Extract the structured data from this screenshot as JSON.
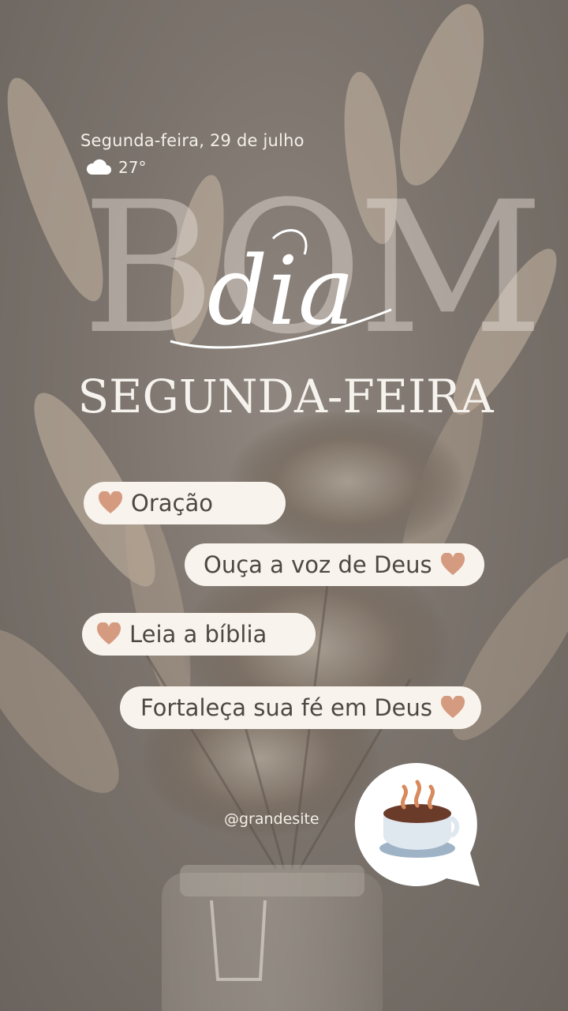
{
  "header": {
    "date": "Segunda-feira, 29 de julho",
    "temperature": "27°"
  },
  "title": {
    "big_word": "BOM",
    "script_word": "dia",
    "weekday": "SEGUNDA-FEIRA"
  },
  "checklist": [
    {
      "label": "Oração"
    },
    {
      "label": "Ouça a voz de Deus"
    },
    {
      "label": "Leia a bíblia"
    },
    {
      "label": "Fortaleça sua fé em Deus"
    }
  ],
  "footer": {
    "handle": "@grandesite"
  },
  "icons": {
    "weather": "cloud-icon",
    "list": "heart-icon",
    "sticker": "hot-coffee-icon"
  },
  "colors": {
    "pill_background": "#f8f3ec",
    "heart": "#d59b80",
    "text_light": "#f4efe9"
  }
}
